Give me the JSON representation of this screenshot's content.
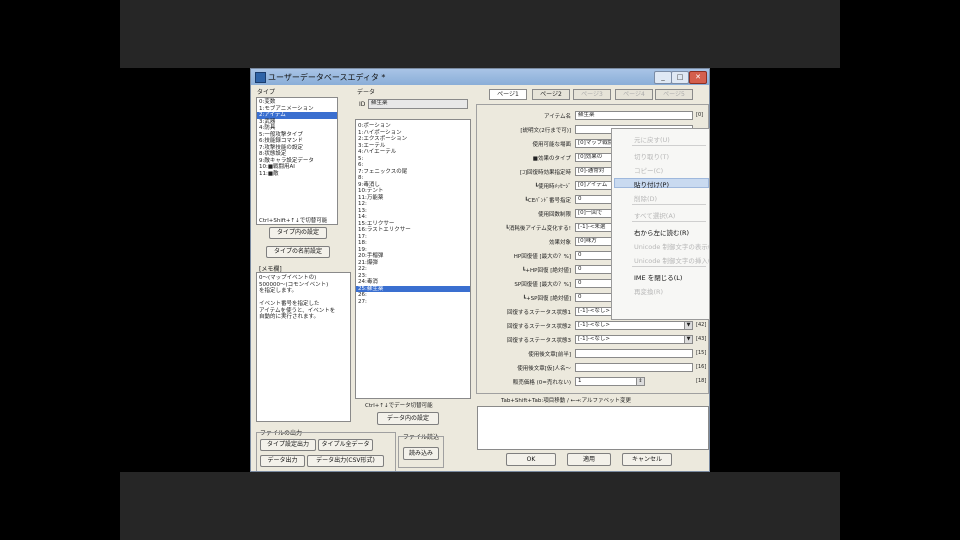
{
  "window": {
    "title": "ユーザーデータベースエディタ *",
    "buttons": {
      "minimize": "_",
      "maximize": "□",
      "close": "✕"
    }
  },
  "type_panel": {
    "label": "タイプ",
    "items": [
      "0:変数",
      "1:モブアニメーション",
      "2:アイテム",
      "3:武器",
      "4:防具",
      "5:一般攻撃タイプ",
      "6:技能録コマンド",
      "7:攻撃技能の設定",
      "8:状態設定",
      "9:敵キャラ設定データ",
      "10:■戦闘用AI",
      "11:■敵",
      ""
    ],
    "selected_index": 2,
    "hint": "Ctrl+Shift+↑↓で切替可能",
    "btn_settings": "タイプ内の設定",
    "btn_name": "タイプの名前設定",
    "memo_label": "[メモ欄]",
    "memo_text": [
      "0〜(マップイベントの)",
      "500000〜(コモンイベント)",
      "を指定します。",
      "",
      "イベント番号を指定した",
      "アイテムを使うと、イベントを",
      "自動的に実行されます。"
    ]
  },
  "data_panel": {
    "label": "データ",
    "id_label": "ID",
    "id_value": "蘇生薬",
    "items": [
      "0:ポーション",
      "1:ハイポーション",
      "2:エクスポーション",
      "3:エーテル",
      "4:ハイエーテル",
      "5:",
      "6:",
      "7:フェニックスの尾",
      "8:",
      "9:毒消し",
      "10:テント",
      "11:万能薬",
      "12:",
      "13:",
      "14:",
      "15:エリクサー",
      "16:ラストエリクサー",
      "17:",
      "18:",
      "19:",
      "20:手榴弾",
      "21:爆弾",
      "22:",
      "23:",
      "24:毒消",
      "25:蘇生薬",
      "26:",
      "27:"
    ],
    "selected_index": 25,
    "hint": "Ctrl+↑↓でデータ切替可能",
    "btn_settings": "データ内の設定"
  },
  "tabs": [
    {
      "label": "ページ1",
      "active": true,
      "disabled": false
    },
    {
      "label": "ページ2",
      "active": false,
      "disabled": false
    },
    {
      "label": "ページ3",
      "active": false,
      "disabled": true
    },
    {
      "label": "ページ4",
      "active": false,
      "disabled": true
    },
    {
      "label": "ページ5",
      "active": false,
      "disabled": true
    }
  ],
  "properties": [
    {
      "label": "アイテム名",
      "value": "蘇生薬",
      "kind": "text",
      "suffix": "[0]"
    },
    {
      "label": "[説明文(2行まで可)]",
      "value": "",
      "kind": "text",
      "suffix": ""
    },
    {
      "label": "使用可能な場面",
      "value": "[0]マップ戦闘",
      "kind": "combo",
      "suffix": ""
    },
    {
      "label": "■効果のタイプ",
      "value": "[0]効果の",
      "kind": "combo",
      "suffix": ""
    },
    {
      "label": "[ｺ]回復時効果指定時",
      "value": "[0]-通常対",
      "kind": "combo",
      "suffix": ""
    },
    {
      "label": "┗使用時ﾒｯｾｰｼﾞ",
      "value": "[0]アイテム",
      "kind": "combo",
      "suffix": ""
    },
    {
      "label": "┗CEﾊﾞﾝﾄﾞ番号指定",
      "value": "0",
      "kind": "text",
      "suffix": ""
    },
    {
      "label": "使用回数制限",
      "value": "[0]一回で",
      "kind": "combo",
      "suffix": ""
    },
    {
      "label": "┗消耗後アイテム変化する!",
      "value": "[-1]-<未選",
      "kind": "combo",
      "suffix": ""
    },
    {
      "label": "効果対象",
      "value": "[0]味方",
      "kind": "combo",
      "suffix": ""
    },
    {
      "label": "HP回復値 [最大の？%]",
      "value": "0",
      "kind": "text",
      "suffix": ""
    },
    {
      "label": "┗+HP回復 [絶対値]",
      "value": "0",
      "kind": "text",
      "suffix": ""
    },
    {
      "label": "SP回復値 [最大の？%]",
      "value": "0",
      "kind": "text",
      "suffix": ""
    },
    {
      "label": "┗+SP回復 [絶対値]",
      "value": "0",
      "kind": "text",
      "suffix": ""
    },
    {
      "label": "回復するステータス状態1",
      "value": "[-1]-<なし>",
      "kind": "combo",
      "suffix": "[41]"
    },
    {
      "label": "回復するステータス状態2",
      "value": "[-1]-<なし>",
      "kind": "combo",
      "suffix": "[42]"
    },
    {
      "label": "回復するステータス状態3",
      "value": "[-1]-<なし>",
      "kind": "combo",
      "suffix": "[43]"
    },
    {
      "label": "使用後文章[前半]",
      "value": "",
      "kind": "text",
      "suffix": "[15]"
    },
    {
      "label": "使用後文章[仮]人名〜",
      "value": "",
      "kind": "text",
      "suffix": "[16]"
    },
    {
      "label": "販売価格 (0=売れない)",
      "value": "1",
      "kind": "spin",
      "suffix": "[18]"
    }
  ],
  "bottom_note": "Tab+Shift+Tab:項目移動 / ←→:アルファベット変更",
  "file_output": {
    "label": "ファイルの出力",
    "btn_type_out": "タイプ設定出力",
    "btn_type_all": "タイプル全データ",
    "btn_data_out": "データ出力",
    "btn_data_csv": "データ出力(CSV形式)"
  },
  "file_read": {
    "label": "ファイル読込",
    "btn": "読み込み"
  },
  "dialog_buttons": {
    "ok": "OK",
    "apply": "適用",
    "cancel": "キャンセル"
  },
  "context_menu": {
    "items": [
      {
        "label": "元に戻す(U)",
        "enabled": false,
        "sep_after": true
      },
      {
        "label": "切り取り(T)",
        "enabled": false,
        "sep_after": false
      },
      {
        "label": "コピー(C)",
        "enabled": false,
        "sep_after": false
      },
      {
        "label": "貼り付け(P)",
        "enabled": true,
        "sep_after": false
      },
      {
        "label": "削除(D)",
        "enabled": false,
        "sep_after": true
      },
      {
        "label": "すべて選択(A)",
        "enabled": false,
        "sep_after": true
      },
      {
        "label": "右から左に読む(R)",
        "enabled": true,
        "sep_after": false
      },
      {
        "label": "Unicode 制御文字の表示(S)",
        "enabled": false,
        "sep_after": false
      },
      {
        "label": "Unicode 制御文字の挿入(I)",
        "enabled": false,
        "sep_after": true
      },
      {
        "label": "IME を閉じる(L)",
        "enabled": true,
        "sep_after": false
      },
      {
        "label": "再変換(R)",
        "enabled": false,
        "sep_after": false
      }
    ],
    "highlighted_index": 3
  }
}
